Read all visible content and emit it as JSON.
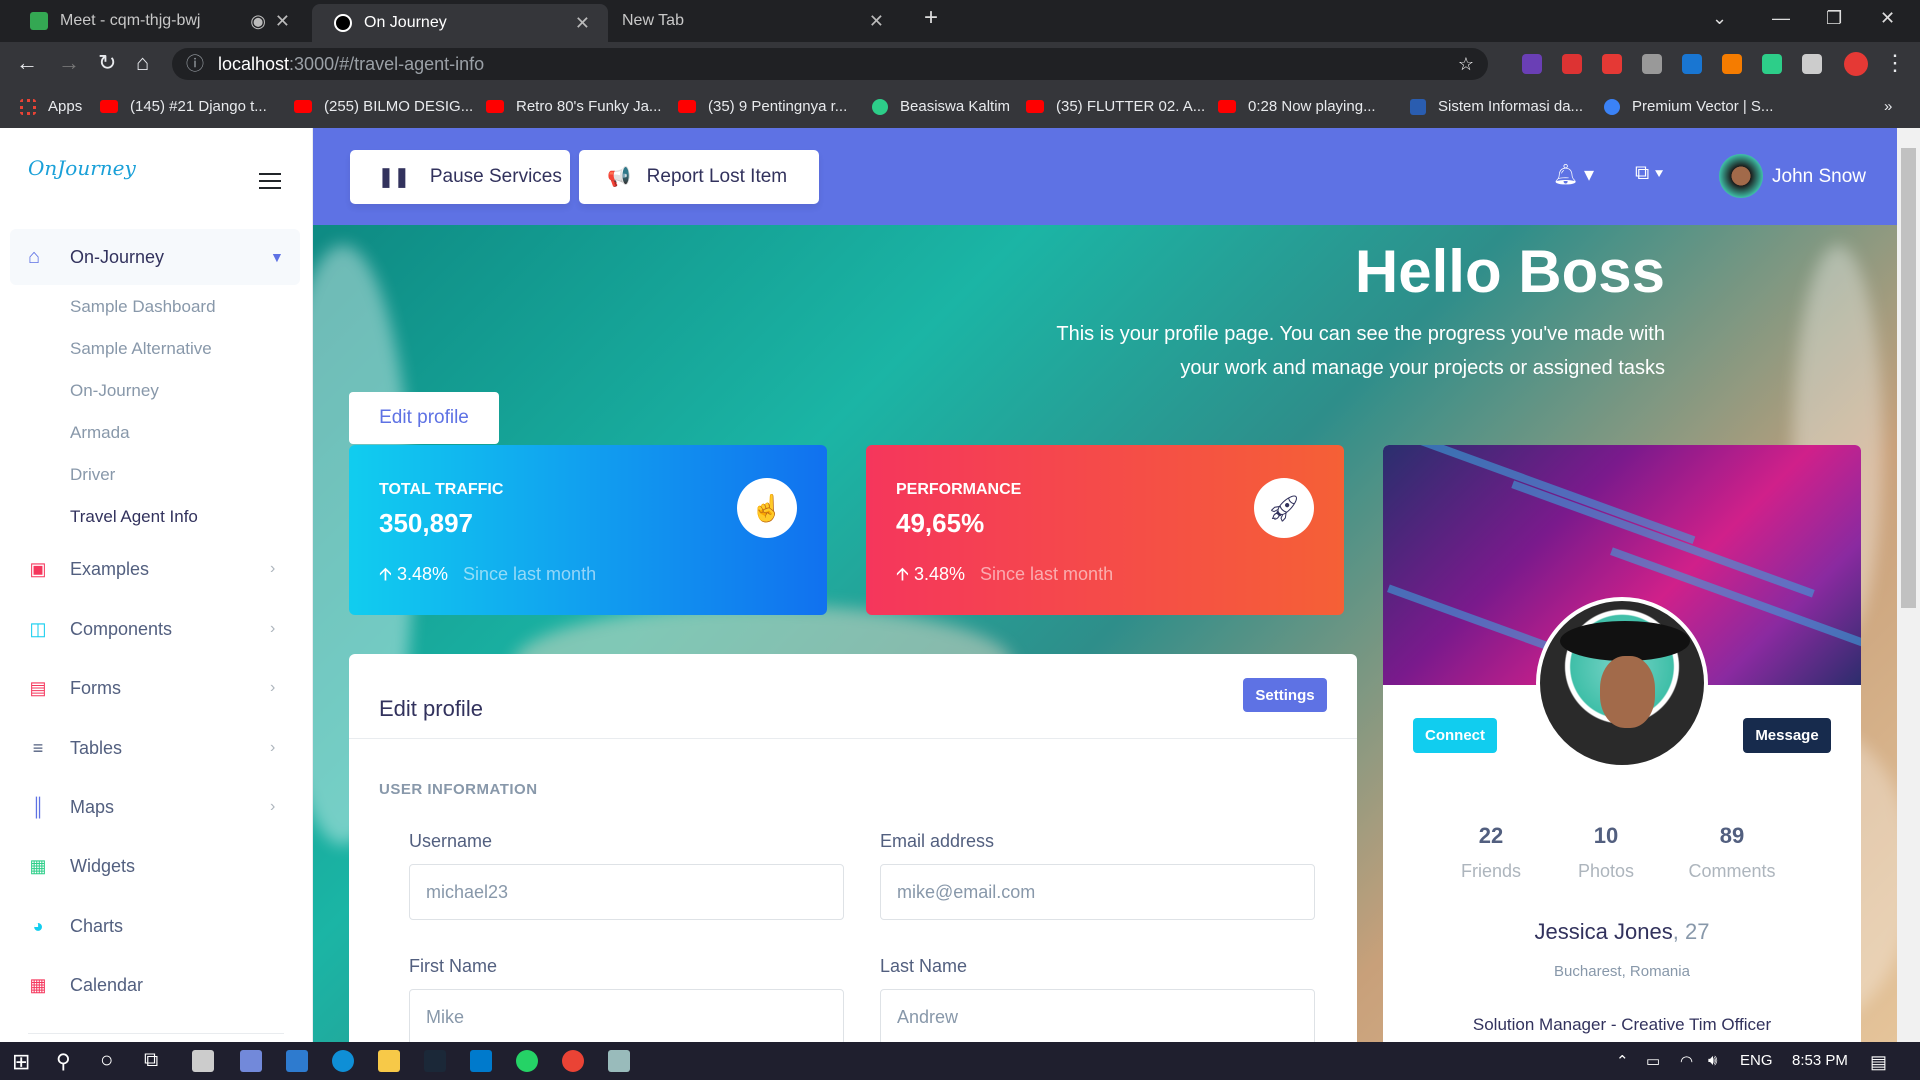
{
  "browser": {
    "tabs": [
      {
        "title": "Meet - cqm-thjg-bwj",
        "active": false
      },
      {
        "title": "On Journey",
        "active": true
      },
      {
        "title": "New Tab",
        "active": false
      }
    ],
    "url_host": "localhost",
    "url_path": ":3000/#/travel-agent-info",
    "bookmarks": [
      "Apps",
      "(145) #21 Django t...",
      "(255) BILMO DESIG...",
      "Retro 80's Funky Ja...",
      "(35) 9 Pentingnya r...",
      "Beasiswa Kaltim",
      "(35) FLUTTER 02. A...",
      "0:28 Now playing...",
      "Sistem Informasi da...",
      "Premium Vector | S..."
    ]
  },
  "sidebar": {
    "logo": "OnJourney",
    "main_item": "On-Journey",
    "sub_items": [
      "Sample Dashboard",
      "Sample Alternative",
      "On-Journey",
      "Armada",
      "Driver",
      "Travel Agent Info"
    ],
    "items": [
      {
        "label": "Examples",
        "icon": "examples-icon",
        "color": "#f5365c"
      },
      {
        "label": "Components",
        "icon": "components-icon",
        "color": "#11cdef"
      },
      {
        "label": "Forms",
        "icon": "forms-icon",
        "color": "#f5365c"
      },
      {
        "label": "Tables",
        "icon": "tables-icon",
        "color": "#525f7f"
      },
      {
        "label": "Maps",
        "icon": "maps-icon",
        "color": "#5e72e4"
      },
      {
        "label": "Widgets",
        "icon": "widgets-icon",
        "color": "#2dce89"
      },
      {
        "label": "Charts",
        "icon": "charts-icon",
        "color": "#11cdef"
      },
      {
        "label": "Calendar",
        "icon": "calendar-icon",
        "color": "#f5365c"
      }
    ]
  },
  "topbar": {
    "pause_label": "Pause Services",
    "report_label": "Report Lost Item",
    "user_name": "John Snow"
  },
  "header": {
    "title": "Hello Boss",
    "description": "This is your profile page. You can see the progress you've made with your work and manage your projects or assigned tasks",
    "edit_button": "Edit profile"
  },
  "stats": [
    {
      "title": "TOTAL TRAFFIC",
      "value": "350,897",
      "change": "3.48%",
      "since": "Since last month"
    },
    {
      "title": "PERFORMANCE",
      "value": "49,65%",
      "change": "3.48%",
      "since": "Since last month"
    }
  ],
  "form": {
    "title": "Edit profile",
    "settings_label": "Settings",
    "section": "USER INFORMATION",
    "fields": [
      {
        "label": "Username",
        "placeholder": "michael23"
      },
      {
        "label": "Email address",
        "placeholder": "mike@email.com"
      },
      {
        "label": "First Name",
        "placeholder": "Mike"
      },
      {
        "label": "Last Name",
        "placeholder": "Andrew"
      }
    ]
  },
  "profile": {
    "connect_label": "Connect",
    "message_label": "Message",
    "stats": [
      {
        "value": "22",
        "label": "Friends"
      },
      {
        "value": "10",
        "label": "Photos"
      },
      {
        "value": "89",
        "label": "Comments"
      }
    ],
    "name": "Jessica Jones",
    "age": ", 27",
    "location": "Bucharest, Romania",
    "role": "Solution Manager - Creative Tim Officer"
  },
  "taskbar": {
    "lang": "ENG",
    "time": "8:53 PM"
  },
  "colors": {
    "primary": "#5e72e4",
    "info": "#11cdef",
    "dark": "#172b4d"
  }
}
